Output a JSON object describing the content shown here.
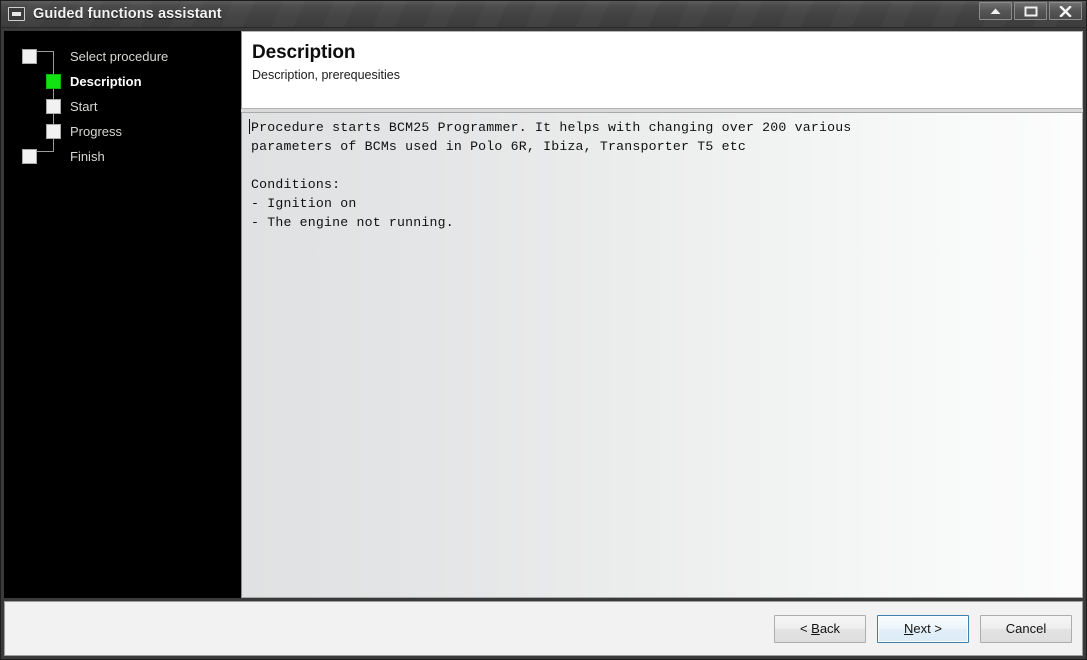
{
  "window": {
    "title": "Guided functions assistant",
    "sysicon": "window-restore-icon",
    "controls": [
      {
        "name": "minimize-button",
        "glyph": "up-arrow"
      },
      {
        "name": "maximize-button",
        "glyph": "restore-box"
      },
      {
        "name": "close-button",
        "glyph": "x"
      }
    ]
  },
  "sidebar": {
    "steps": [
      {
        "label": "Select procedure",
        "state": "pending",
        "position": "end"
      },
      {
        "label": "Description",
        "state": "current",
        "position": "mid"
      },
      {
        "label": "Start",
        "state": "pending",
        "position": "mid"
      },
      {
        "label": "Progress",
        "state": "pending",
        "position": "mid"
      },
      {
        "label": "Finish",
        "state": "pending",
        "position": "end"
      }
    ],
    "current_color": "#12e212"
  },
  "header": {
    "title": "Description",
    "subtitle": "Description, prerequesities"
  },
  "main": {
    "body_text": "Procedure starts BCM25 Programmer. It helps with changing over 200 various\nparameters of BCMs used in Polo 6R, Ibiza, Transporter T5 etc\n\nConditions:\n- Ignition on\n- The engine not running."
  },
  "footer": {
    "buttons": [
      {
        "name": "back-button",
        "prefix": "< ",
        "mnemonic": "B",
        "suffix": "ack",
        "focused": false
      },
      {
        "name": "next-button",
        "prefix": "",
        "mnemonic": "N",
        "suffix": "ext >",
        "focused": true
      },
      {
        "name": "cancel-button",
        "prefix": "",
        "mnemonic": "",
        "suffix": "Cancel",
        "focused": false
      }
    ]
  }
}
